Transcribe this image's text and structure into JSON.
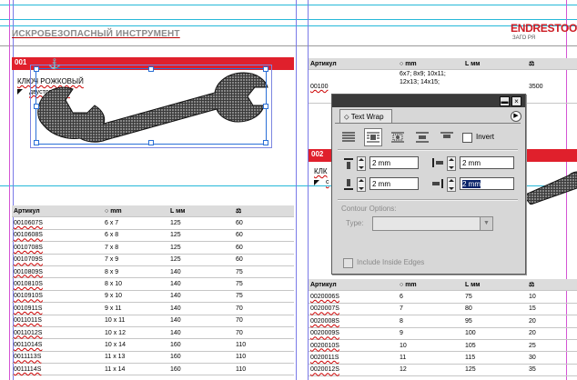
{
  "page": {
    "title": "ИСКРОБЕЗОПАСНЫЙ ИНСТРУМЕНТ",
    "logo": "ENDRESTOOL",
    "logo_sub": "ЗАГО РЯ"
  },
  "product1": {
    "num": "001",
    "name": "КЛЮЧ РОЖКОВЫЙ",
    "sub": "двусторонний",
    "table": {
      "headers": [
        "Артикул",
        "mm",
        "L мм",
        ""
      ],
      "rows": [
        [
          "0010607S",
          "6 x 7",
          "125",
          "60"
        ],
        [
          "0010608S",
          "6 x 8",
          "125",
          "60"
        ],
        [
          "0010708S",
          "7 x 8",
          "125",
          "60"
        ],
        [
          "0010709S",
          "7 x 9",
          "125",
          "60"
        ],
        [
          "0010809S",
          "8 x 9",
          "140",
          "75"
        ],
        [
          "0010810S",
          "8 x 10",
          "140",
          "75"
        ],
        [
          "0010910S",
          "9 x 10",
          "140",
          "75"
        ],
        [
          "0010911S",
          "9 x 11",
          "140",
          "70"
        ],
        [
          "0011011S",
          "10 x 11",
          "140",
          "70"
        ],
        [
          "0011012S",
          "10 x 12",
          "140",
          "70"
        ],
        [
          "0011014S",
          "10 x 14",
          "160",
          "110"
        ],
        [
          "0011113S",
          "11 x 13",
          "160",
          "110"
        ],
        [
          "0011114S",
          "11 x 14",
          "160",
          "110"
        ]
      ]
    }
  },
  "product2": {
    "num": "002",
    "name": "КЛК",
    "sub": "с",
    "table_top": {
      "headers": [
        "Артикул",
        "mm",
        "L мм",
        ""
      ],
      "row": {
        "art": "00100",
        "sizes": "6x7; 8x9; 10x11; 12x13; 14x15;",
        "len": "3500"
      }
    },
    "table": {
      "headers": [
        "Артикул",
        "mm",
        "L мм",
        ""
      ],
      "rows": [
        [
          "0020006S",
          "6",
          "75",
          "10"
        ],
        [
          "0020007S",
          "7",
          "80",
          "15"
        ],
        [
          "0020008S",
          "8",
          "95",
          "20"
        ],
        [
          "0020009S",
          "9",
          "100",
          "20"
        ],
        [
          "0020010S",
          "10",
          "105",
          "25"
        ],
        [
          "0020011S",
          "11",
          "115",
          "30"
        ],
        [
          "0020012S",
          "12",
          "125",
          "35"
        ]
      ]
    }
  },
  "panel": {
    "tab": "Text Wrap",
    "invert_label": "Invert",
    "top_offset": "2 mm",
    "bottom_offset": "2 mm",
    "left_offset": "2 mm",
    "right_offset": "2 mm",
    "contour_label": "Contour Options:",
    "type_label": "Type:",
    "include_label": "Include Inside Edges"
  },
  "icons": [
    "close-icon",
    "minimize-icon",
    "panel-menu-icon",
    "wrap-none-icon",
    "wrap-bbox-icon",
    "wrap-shape-icon",
    "wrap-jump-icon",
    "wrap-next-column-icon",
    "top-offset-icon",
    "bottom-offset-icon",
    "left-offset-icon",
    "right-offset-icon",
    "diameter-icon",
    "weight-icon"
  ]
}
